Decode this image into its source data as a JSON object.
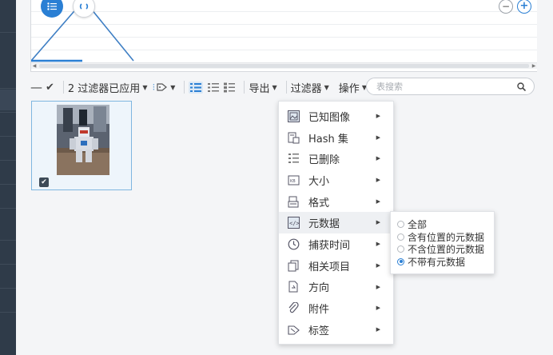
{
  "toolbar": {
    "filters_applied_label": "2 过滤器已应用",
    "export_label": "导出",
    "filter_label": "过滤器",
    "action_label": "操作",
    "search_placeholder": "表搜索"
  },
  "thumbnail": {
    "checked": true
  },
  "filter_menu": {
    "items": [
      {
        "label": "已知图像",
        "icon": "known-image-icon"
      },
      {
        "label": "Hash 集",
        "icon": "hash-set-icon"
      },
      {
        "label": "已删除",
        "icon": "deleted-icon"
      },
      {
        "label": "大小",
        "icon": "size-icon"
      },
      {
        "label": "格式",
        "icon": "format-icon"
      },
      {
        "label": "元数据",
        "icon": "metadata-icon"
      },
      {
        "label": "捕获时间",
        "icon": "clock-icon"
      },
      {
        "label": "相关项目",
        "icon": "related-items-icon"
      },
      {
        "label": "方向",
        "icon": "orientation-icon"
      },
      {
        "label": "附件",
        "icon": "paperclip-icon"
      },
      {
        "label": "标签",
        "icon": "tag-icon"
      }
    ],
    "active_index": 5
  },
  "metadata_submenu": {
    "options": [
      {
        "label": "全部",
        "selected": false
      },
      {
        "label": "含有位置的元数据",
        "selected": false
      },
      {
        "label": "不含位置的元数据",
        "selected": false
      },
      {
        "label": "不带有元数据",
        "selected": true
      }
    ]
  },
  "colors": {
    "accent": "#2a7fd4",
    "sidebar": "#2f3b49",
    "selection_border": "#7fb6e0"
  }
}
